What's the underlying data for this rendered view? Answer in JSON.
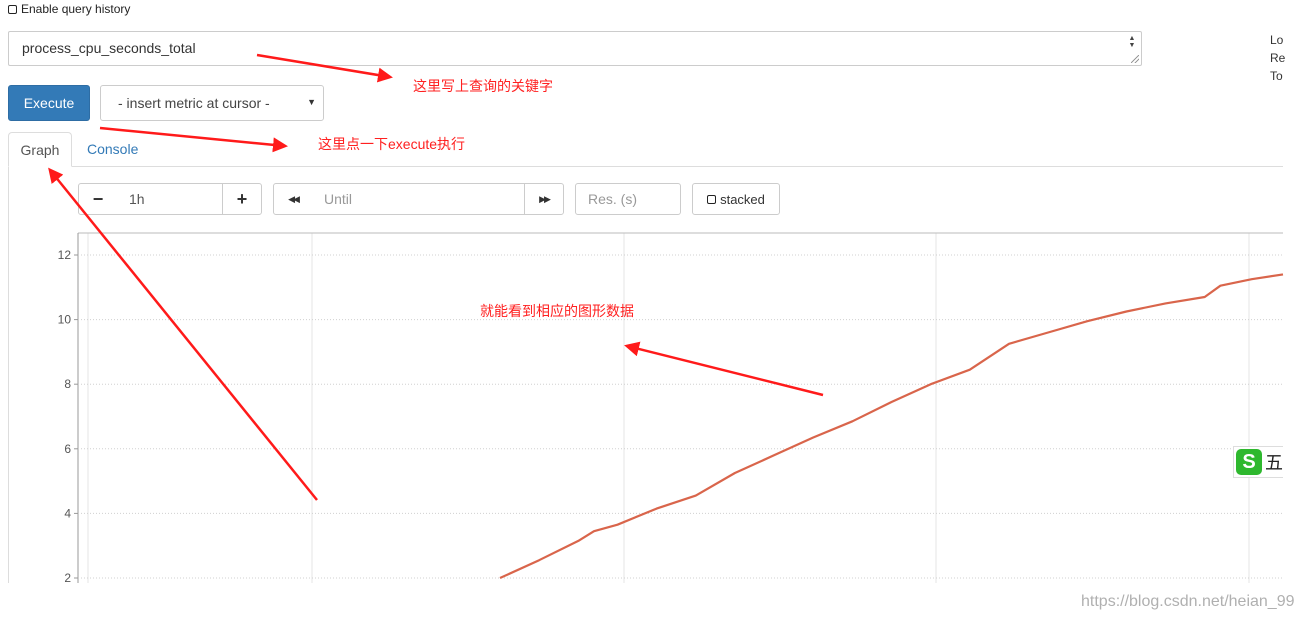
{
  "query_history": {
    "label": "Enable query history"
  },
  "expression": {
    "value": "process_cpu_seconds_total"
  },
  "side_panel": {
    "lines": [
      "Lo",
      "Re",
      "To"
    ]
  },
  "execute": {
    "label": "Execute"
  },
  "metric_select": {
    "selected": "- insert metric at cursor -"
  },
  "tabs": [
    {
      "label": "Graph",
      "active": true
    },
    {
      "label": "Console",
      "active": false
    }
  ],
  "graph_controls": {
    "range_minus": "−",
    "range_value": "1h",
    "range_plus": "+",
    "back_icon": "◀◀",
    "until_placeholder": "Until",
    "forward_icon": "▶▶",
    "resolution_placeholder": "Res. (s)",
    "stacked_label": "stacked"
  },
  "annotations": {
    "query_note": "这里写上查询的关键字",
    "execute_note": "这里点一下execute执行",
    "graph_note": "就能看到相应的图形数据"
  },
  "watermark": {
    "logo_letter": "S",
    "logo_char": "五",
    "site": "https://blog.csdn.net/heian_99"
  },
  "colors": {
    "series": "#d9654b",
    "arrow": "#ff1a1a",
    "accent": "#337ab7"
  },
  "chart_data": {
    "type": "line",
    "y_ticks": [
      2,
      4,
      6,
      8,
      10,
      12
    ],
    "ylim": [
      2,
      12.7
    ],
    "grid": true,
    "series": [
      {
        "color": "#d9654b",
        "points": [
          [
            0.0,
            2.0
          ],
          [
            0.05,
            2.55
          ],
          [
            0.1,
            3.15
          ],
          [
            0.12,
            3.45
          ],
          [
            0.15,
            3.65
          ],
          [
            0.2,
            4.15
          ],
          [
            0.25,
            4.55
          ],
          [
            0.3,
            5.25
          ],
          [
            0.35,
            5.8
          ],
          [
            0.4,
            6.35
          ],
          [
            0.45,
            6.85
          ],
          [
            0.5,
            7.45
          ],
          [
            0.55,
            8.0
          ],
          [
            0.6,
            8.45
          ],
          [
            0.65,
            9.25
          ],
          [
            0.7,
            9.6
          ],
          [
            0.75,
            9.95
          ],
          [
            0.8,
            10.25
          ],
          [
            0.85,
            10.5
          ],
          [
            0.9,
            10.7
          ],
          [
            0.92,
            11.05
          ],
          [
            0.96,
            11.25
          ],
          [
            1.0,
            11.4
          ]
        ]
      }
    ]
  }
}
